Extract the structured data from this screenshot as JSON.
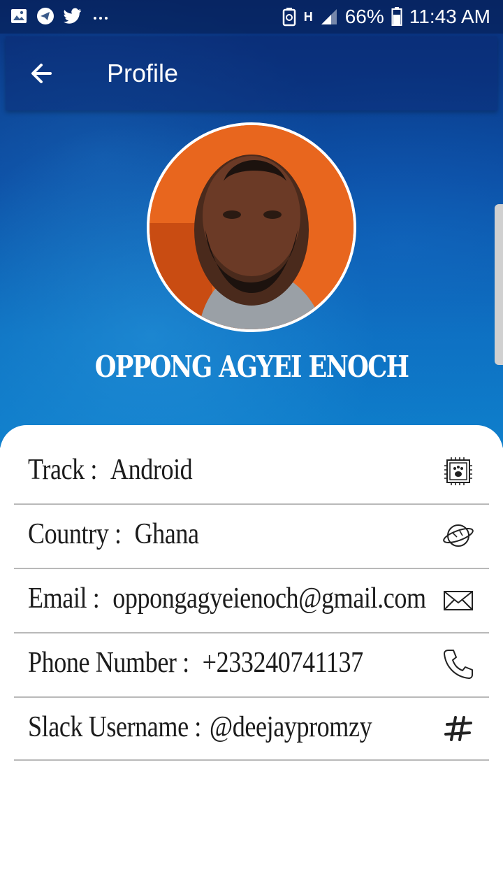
{
  "status_bar": {
    "battery": "66%",
    "time": "11:43 AM",
    "network": "H",
    "left_icons": [
      "gallery-icon",
      "telegram-icon",
      "twitter-icon",
      "more-dots-icon"
    ]
  },
  "app_bar": {
    "title": "Profile",
    "back_icon": "back-arrow-icon"
  },
  "profile": {
    "name": "OPPONG AGYEI ENOCH"
  },
  "details": [
    {
      "label": "Track :",
      "value": "Android",
      "icon": "chip-icon"
    },
    {
      "label": "Country :",
      "value": "Ghana",
      "icon": "planet-icon"
    },
    {
      "label": "Email :",
      "value": "oppongagyeienoch@gmail.com",
      "icon": "mail-icon"
    },
    {
      "label": "Phone Number :",
      "value": "+233240741137",
      "icon": "phone-icon"
    },
    {
      "label": "Slack Username :",
      "value": "@deejaypromzy",
      "icon": "hashtag-icon"
    }
  ],
  "colors": {
    "hero_top": "#0a2f7a",
    "hero_bottom": "#0f7fcc",
    "card": "#ffffff",
    "divider": "#b9b9b9"
  }
}
